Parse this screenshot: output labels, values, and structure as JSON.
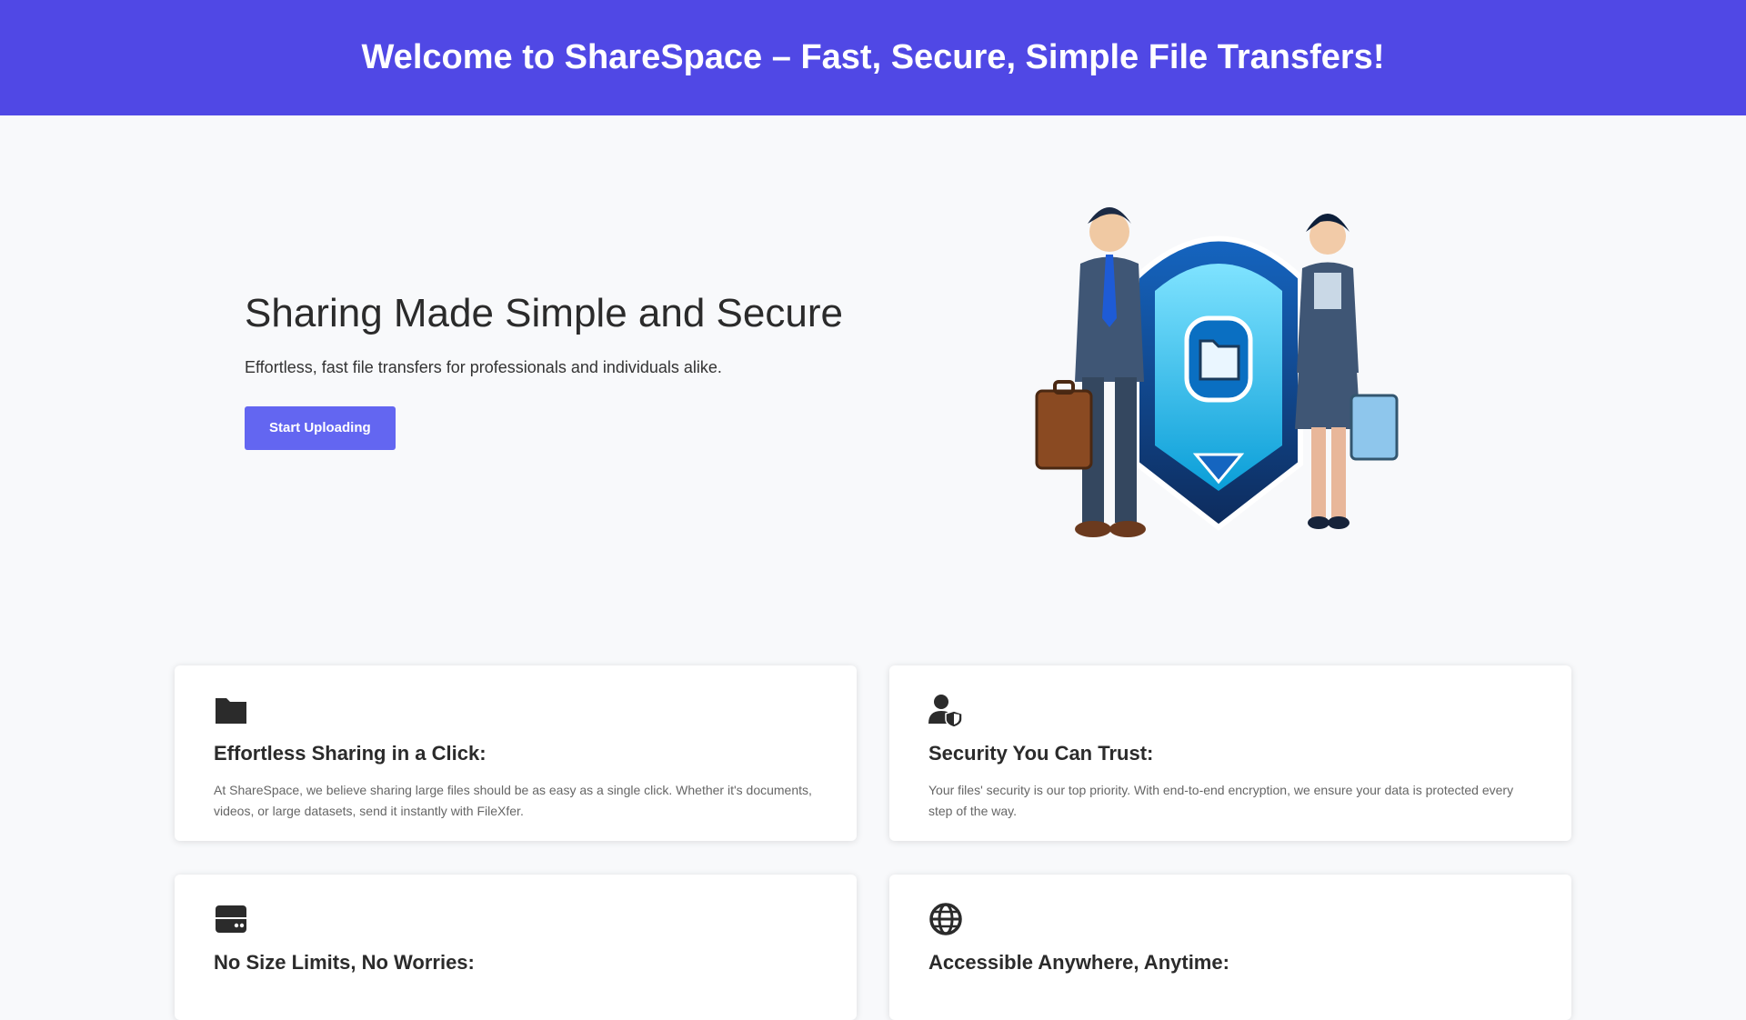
{
  "header": {
    "title": "Welcome to ShareSpace – Fast, Secure, Simple File Transfers!",
    "background": "#5048e5"
  },
  "hero": {
    "title": "Sharing Made Simple and Secure",
    "subtitle": "Effortless, fast file transfers for professionals and individuals alike.",
    "cta_label": "Start Uploading",
    "cta_color": "#6366f1",
    "illustration": "two-professionals-with-secure-file-shield"
  },
  "features": [
    {
      "icon": "folder-icon",
      "title": "Effortless Sharing in a Click:",
      "text": "At ShareSpace, we believe sharing large files should be as easy as a single click. Whether it's documents, videos, or large datasets, send it instantly with FileXfer."
    },
    {
      "icon": "user-shield-icon",
      "title": "Security You Can Trust:",
      "text": "Your files' security is our top priority. With end-to-end encryption, we ensure your data is protected every step of the way."
    },
    {
      "icon": "hard-drive-icon",
      "title": "No Size Limits, No Worries:",
      "text": ""
    },
    {
      "icon": "globe-icon",
      "title": "Accessible Anywhere, Anytime:",
      "text": ""
    }
  ]
}
